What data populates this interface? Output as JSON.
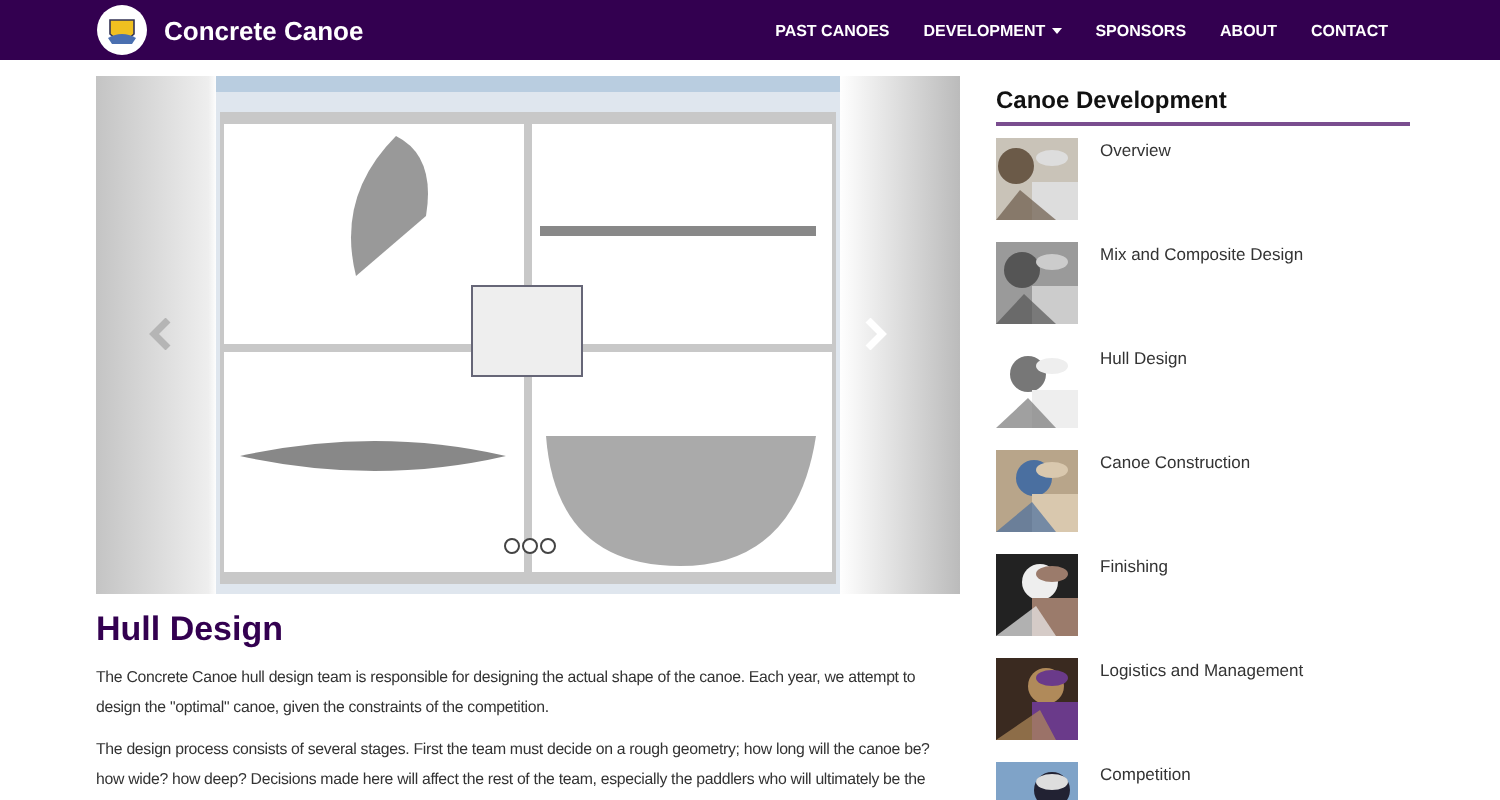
{
  "navbar": {
    "title": "Concrete Canoe",
    "links": [
      {
        "label": "PAST CANOES",
        "dropdown": false
      },
      {
        "label": "DEVELOPMENT",
        "dropdown": true
      },
      {
        "label": "SPONSORS",
        "dropdown": false
      },
      {
        "label": "ABOUT",
        "dropdown": false
      },
      {
        "label": "CONTACT",
        "dropdown": false
      }
    ]
  },
  "slider": {
    "dots": [
      {
        "selected": false
      },
      {
        "selected": false
      },
      {
        "selected": false
      }
    ]
  },
  "article": {
    "heading": "Hull Design",
    "paragraphs": [
      "The Concrete Canoe hull design team is responsible for designing the actual shape of the canoe. Each year, we attempt to design the \"optimal\" canoe, given the constraints of the competition.",
      "The design process consists of several stages. First the team must decide on a rough geometry; how long will the canoe be? how wide? how deep? Decisions made here will affect the rest of the team, especially the paddlers who will ultimately be the"
    ]
  },
  "sidebar": {
    "title": "Canoe Development",
    "items": [
      {
        "label": "Overview"
      },
      {
        "label": "Mix and Composite Design"
      },
      {
        "label": "Hull Design"
      },
      {
        "label": "Canoe Construction"
      },
      {
        "label": "Finishing"
      },
      {
        "label": "Logistics and Management"
      },
      {
        "label": "Competition"
      }
    ]
  }
}
